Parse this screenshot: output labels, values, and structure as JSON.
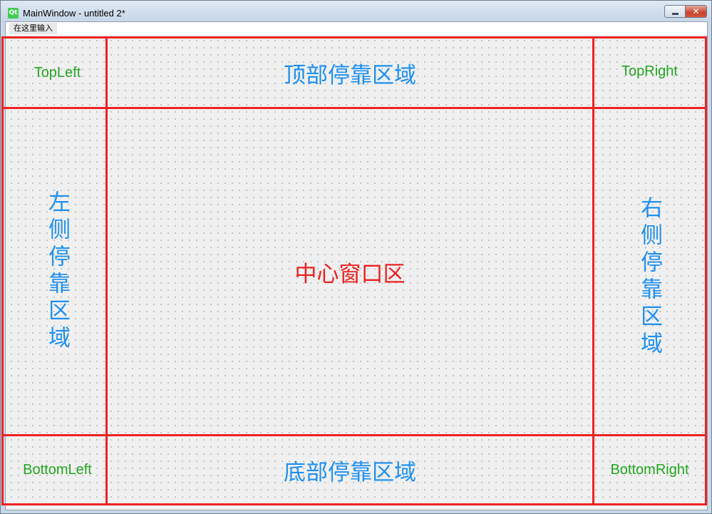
{
  "window": {
    "logo_text": "Qt",
    "title": "MainWindow - untitled 2*",
    "minimize_icon": "minimize-icon",
    "close_icon": "close-icon",
    "close_glyph": "✕"
  },
  "menubar": {
    "placeholder_item": "在这里输入"
  },
  "layout": {
    "top_left": "TopLeft",
    "top_dock": "顶部停靠区域",
    "top_right": "TopRight",
    "left_dock": "左侧停靠区域",
    "central": "中心窗口区",
    "right_dock": "右侧停靠区域",
    "bottom_left": "BottomLeft",
    "bottom_dock": "底部停靠区域",
    "bottom_right": "BottomRight"
  },
  "colors": {
    "frame_red": "#ee2222",
    "corner_label_green": "#22a622",
    "dock_label_blue": "#1e90f0",
    "central_label_red": "#ee2020"
  }
}
